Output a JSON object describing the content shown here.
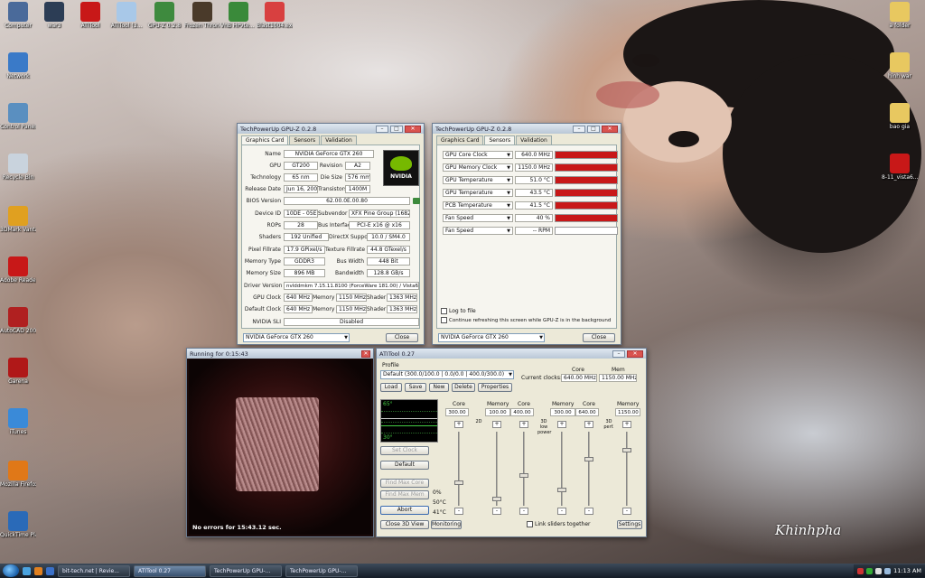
{
  "desktop_icons_left": [
    {
      "label": "Computer",
      "color": "#4a6a9a"
    },
    {
      "label": "Network",
      "color": "#3a7ac8"
    },
    {
      "label": "Control Panel",
      "color": "#5a8fc0"
    },
    {
      "label": "Recycle Bin",
      "color": "#c9d3dd"
    },
    {
      "label": "3DMark Vantage",
      "color": "#e0a020"
    },
    {
      "label": "Adobe Reader 9",
      "color": "#c81818"
    },
    {
      "label": "AutoCAD 2007",
      "color": "#b02020"
    },
    {
      "label": "Garena",
      "color": "#b01818"
    },
    {
      "label": "iTunes",
      "color": "#3a8ad8"
    },
    {
      "label": "Mozilla Firefox",
      "color": "#e07818"
    },
    {
      "label": "QuickTime Player",
      "color": "#2a6ab8"
    }
  ],
  "desktop_icons_top": [
    {
      "label": "war3",
      "color": "#2c3d55"
    },
    {
      "label": "ATITool",
      "color": "#c81818"
    },
    {
      "label": "ATITool (3...",
      "color": "#a8c8e8"
    },
    {
      "label": "GPU-Z 0.2.8",
      "color": "#3e8a3e"
    },
    {
      "label": "Frozen Throne.e...",
      "color": "#4a3a2a"
    },
    {
      "label": "VnB HPvte... - Shortcut",
      "color": "#3a8a3a"
    },
    {
      "label": "Blast1004.exe",
      "color": "#d84040"
    }
  ],
  "desktop_icons_right": [
    {
      "label": "a folder",
      "color": "#e8c860"
    },
    {
      "label": "hinh war",
      "color": "#e8c860"
    },
    {
      "label": "bao gia",
      "color": "#e8c860"
    },
    {
      "label": "8-11_vista6...",
      "color": "#c81818"
    }
  ],
  "gpuz1": {
    "title": "TechPowerUp GPU-Z 0.2.8",
    "tabs": [
      "Graphics Card",
      "Sensors",
      "Validation"
    ],
    "fields": {
      "name_label": "Name",
      "name": "NVIDIA GeForce GTX 260",
      "gpu_label": "GPU",
      "gpu": "GT200",
      "revision_label": "Revision",
      "revision": "A2",
      "technology_label": "Technology",
      "technology": "65 nm",
      "diesize_label": "Die Size",
      "diesize": "576 mm²",
      "release_label": "Release Date",
      "release": "Jun 16, 2008",
      "transistors_label": "Transistors",
      "transistors": "1400M",
      "bios_label": "BIOS Version",
      "bios": "62.00.0E.00.80",
      "deviceid_label": "Device ID",
      "deviceid": "10DE - 05E2",
      "subvendor_label": "Subvendor",
      "subvendor": "XFX Pine Group (1682)",
      "rops_label": "ROPs",
      "rops": "28",
      "businterface_label": "Bus Interface",
      "businterface": "PCI-E x16 @ x16",
      "shaders_label": "Shaders",
      "shaders": "192 Unified",
      "directx_label": "DirectX Support",
      "directx": "10.0 / SM4.0",
      "pixelfill_label": "Pixel Fillrate",
      "pixelfill": "17.9 GPixel/s",
      "texturefill_label": "Texture Fillrate",
      "texturefill": "44.8 GTexel/s",
      "memtype_label": "Memory Type",
      "memtype": "GDDR3",
      "buswidth_label": "Bus Width",
      "buswidth": "448 Bit",
      "memsize_label": "Memory Size",
      "memsize": "896 MB",
      "bandwidth_label": "Bandwidth",
      "bandwidth": "128.8 GB/s",
      "driver_label": "Driver Version",
      "driver": "nvlddmkm 7.15.11.8100 (ForceWare 181.00) / Vista64",
      "gpuclock_label": "GPU Clock",
      "gpuclock": "640 MHz",
      "memory_label": "Memory",
      "gpuclock_mem": "1150 MHz",
      "shader_label": "Shader",
      "gpuclock_shader": "1363 MHz",
      "defclock_label": "Default Clock",
      "defclock": "640 MHz",
      "defclock_mem": "1150 MHz",
      "defclock_shader": "1363 MHz",
      "sli_label": "NVIDIA SLI",
      "sli": "Disabled"
    },
    "logo_text": "NVIDIA",
    "card_select": "NVIDIA GeForce GTX 260",
    "close_label": "Close"
  },
  "gpuz2": {
    "title": "TechPowerUp GPU-Z 0.2.8",
    "tabs": [
      "Graphics Card",
      "Sensors",
      "Validation"
    ],
    "sensors": [
      {
        "name": "GPU Core Clock",
        "value": "640.0 MHz",
        "fill": 1.0
      },
      {
        "name": "GPU Memory Clock",
        "value": "1150.0 MHz",
        "fill": 1.0
      },
      {
        "name": "GPU Temperature",
        "value": "51.0 °C",
        "fill": 1.0
      },
      {
        "name": "GPU Temperature",
        "value": "43.5 °C",
        "fill": 1.0
      },
      {
        "name": "PCB Temperature",
        "value": "41.5 °C",
        "fill": 1.0
      },
      {
        "name": "Fan Speed",
        "value": "40 %",
        "fill": 1.0
      },
      {
        "name": "Fan Speed",
        "value": "-- RPM",
        "fill": 0.0
      }
    ],
    "log_label": "Log to file",
    "refresh_label": "Continue refreshing this screen while GPU-Z is in the background",
    "card_select": "NVIDIA GeForce GTX 260",
    "close_label": "Close"
  },
  "running": {
    "title": "Running for 0:15:43",
    "status": "No errors for 15:43.12 sec."
  },
  "atitool": {
    "title": "ATITool 0.27",
    "profile_label": "Profile",
    "profile_select": "Default (300.0/100.0 | 0.0/0.0 | 400.0/300.0)",
    "core_header": "Core",
    "mem_header": "Mem",
    "current_clocks_label": "Current clocks:",
    "current_core": "640.00 MHz",
    "current_mem": "1150.00 MHz",
    "buttons": {
      "load": "Load",
      "save": "Save",
      "new": "New",
      "delete": "Delete",
      "properties": "Properties"
    },
    "graph_top": "65°",
    "graph_bottom": "30°",
    "left_buttons": {
      "set_clock": "Set Clock",
      "default": "Default",
      "find_max_core": "Find Max Core",
      "find_max_mem": "Find Max Mem",
      "abort": "Abort",
      "close_3d": "Close 3D View"
    },
    "status_values": [
      "0%",
      "50°C",
      "41°C"
    ],
    "groups": [
      {
        "mode": "2D",
        "core_label": "Core",
        "mem_label": "Memory",
        "core": "300.00",
        "mem": "100.00"
      },
      {
        "mode": "3D low power",
        "core_label": "Core",
        "mem_label": "Memory",
        "core": "400.00",
        "mem": "300.00"
      },
      {
        "mode": "3D perf.",
        "core_label": "Core",
        "mem_label": "Memory",
        "core": "640.00",
        "mem": "1150.00"
      }
    ],
    "plus": "+",
    "minus": "-",
    "monitoring_label": "Monitoring",
    "link_label": "Link sliders together",
    "settings_label": "Settings"
  },
  "taskbar": {
    "tasks": [
      "bit-tech.net | Revie...",
      "ATITool 0.27",
      "TechPowerUp GPU-...",
      "TechPowerUp GPU-..."
    ],
    "clock": "11:13 AM"
  },
  "watermark": "Khinhpha"
}
